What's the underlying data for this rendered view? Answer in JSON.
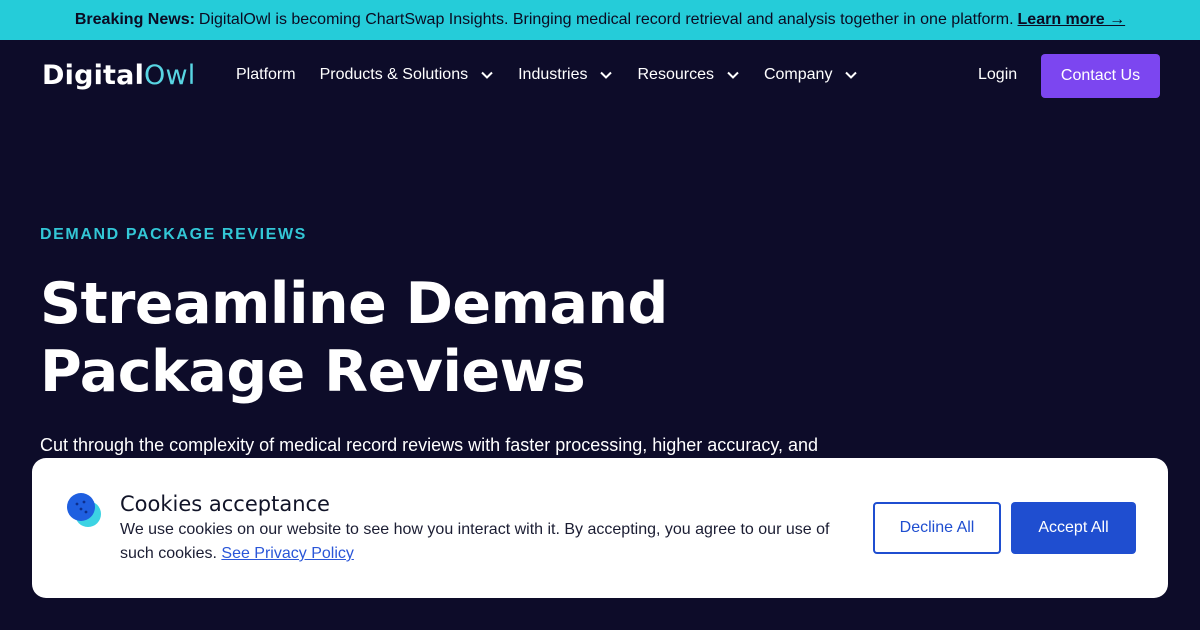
{
  "banner": {
    "label": "Breaking News:",
    "text": "DigitalOwl is becoming ChartSwap Insights. Bringing medical record retrieval and analysis together in one platform.",
    "link": "Learn more →"
  },
  "logo": {
    "part1": "Digital",
    "part2": "Owl"
  },
  "nav": {
    "items": [
      {
        "label": "Platform"
      },
      {
        "label": "Products & Solutions"
      },
      {
        "label": "Industries"
      },
      {
        "label": "Resources"
      },
      {
        "label": "Company"
      }
    ],
    "login": "Login",
    "contact": "Contact Us"
  },
  "hero": {
    "eyebrow": "DEMAND PACKAGE REVIEWS",
    "headline_line1": "Streamline Demand",
    "headline_line2": "Package Reviews",
    "lede": "Cut through the complexity of medical record reviews with faster processing, higher accuracy, and"
  },
  "cookie": {
    "title": "Cookies acceptance",
    "text": "We use cookies on our website to see how you interact with it. By accepting, you agree to our use of such cookies.",
    "link": "See Privacy Policy",
    "decline": "Decline All",
    "accept": "Accept All"
  },
  "colors": {
    "background": "#0d0c29",
    "banner": "#25ccd9",
    "accent_purple": "#7c46f0",
    "accent_cyan": "#33c7d6",
    "button_blue": "#1f4ed0"
  }
}
